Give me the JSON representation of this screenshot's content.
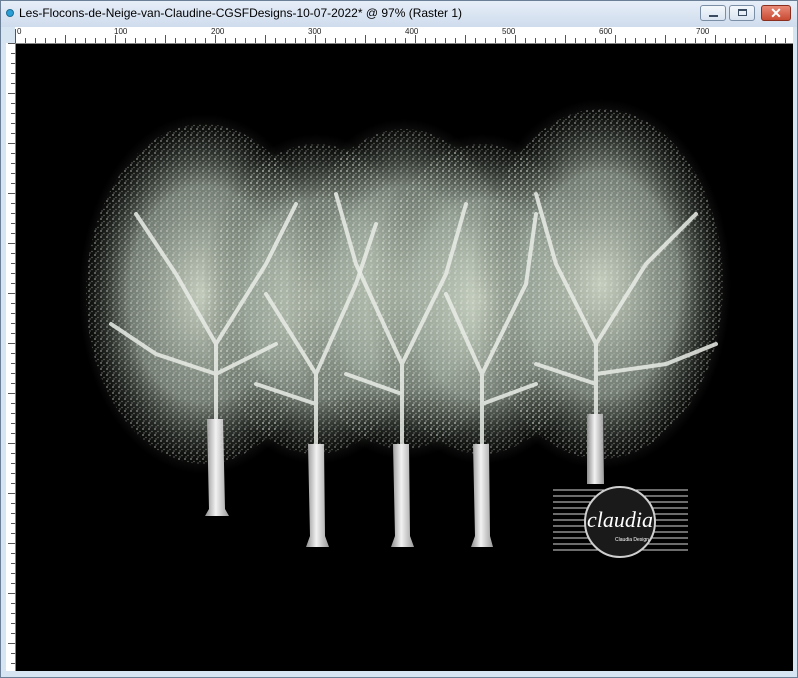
{
  "window": {
    "title": "Les-Flocons-de-Neige-van-Claudine-CGSFDesigns-10-07-2022* @  97% (Raster 1)",
    "buttons": {
      "minimize": "minimize-icon",
      "maximize": "maximize-icon",
      "close": "close-icon"
    },
    "close_color": "#c94b33"
  },
  "ruler": {
    "labels": [
      "0",
      "100",
      "200",
      "300",
      "400",
      "500",
      "600",
      "700"
    ]
  },
  "canvas": {
    "background": "#000000",
    "subject": "five-snow-covered-trees",
    "watermark": {
      "text": "claudia",
      "subtext": "Claudia Design"
    }
  }
}
